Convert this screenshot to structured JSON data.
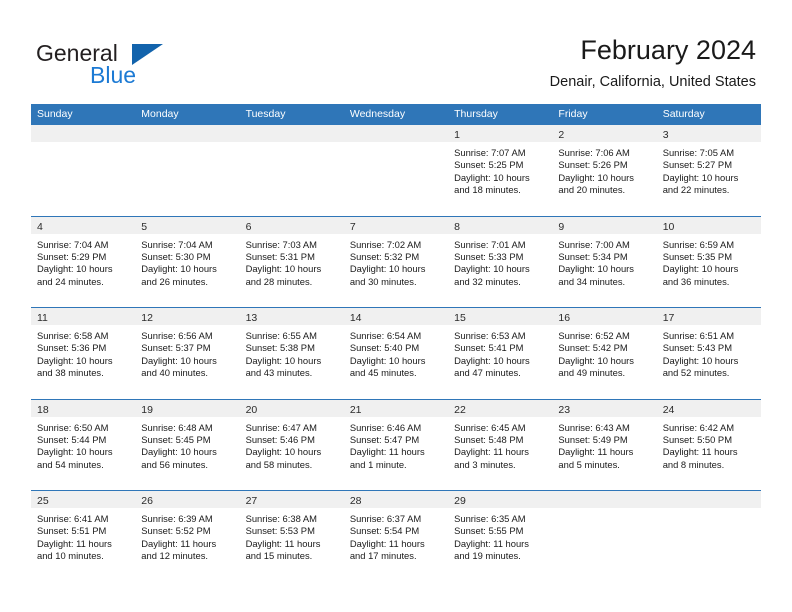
{
  "brand": {
    "name_part1": "General",
    "name_part2": "Blue",
    "accent_color": "#1263ac",
    "blue_text_color": "#1c7ad4"
  },
  "header": {
    "title": "February 2024",
    "subtitle": "Denair, California, United States"
  },
  "theme": {
    "header_row_bg": "#2f76b8",
    "day_number_band_bg": "#f0f0f0",
    "separator_color": "#2f76b8",
    "text_color": "#1a1a1a"
  },
  "weekday_headers": [
    "Sunday",
    "Monday",
    "Tuesday",
    "Wednesday",
    "Thursday",
    "Friday",
    "Saturday"
  ],
  "weeks": [
    [
      {
        "day": "",
        "sunrise": "",
        "sunset": "",
        "daylight_line1": "",
        "daylight_line2": ""
      },
      {
        "day": "",
        "sunrise": "",
        "sunset": "",
        "daylight_line1": "",
        "daylight_line2": ""
      },
      {
        "day": "",
        "sunrise": "",
        "sunset": "",
        "daylight_line1": "",
        "daylight_line2": ""
      },
      {
        "day": "",
        "sunrise": "",
        "sunset": "",
        "daylight_line1": "",
        "daylight_line2": ""
      },
      {
        "day": "1",
        "sunrise": "Sunrise: 7:07 AM",
        "sunset": "Sunset: 5:25 PM",
        "daylight_line1": "Daylight: 10 hours",
        "daylight_line2": "and 18 minutes."
      },
      {
        "day": "2",
        "sunrise": "Sunrise: 7:06 AM",
        "sunset": "Sunset: 5:26 PM",
        "daylight_line1": "Daylight: 10 hours",
        "daylight_line2": "and 20 minutes."
      },
      {
        "day": "3",
        "sunrise": "Sunrise: 7:05 AM",
        "sunset": "Sunset: 5:27 PM",
        "daylight_line1": "Daylight: 10 hours",
        "daylight_line2": "and 22 minutes."
      }
    ],
    [
      {
        "day": "4",
        "sunrise": "Sunrise: 7:04 AM",
        "sunset": "Sunset: 5:29 PM",
        "daylight_line1": "Daylight: 10 hours",
        "daylight_line2": "and 24 minutes."
      },
      {
        "day": "5",
        "sunrise": "Sunrise: 7:04 AM",
        "sunset": "Sunset: 5:30 PM",
        "daylight_line1": "Daylight: 10 hours",
        "daylight_line2": "and 26 minutes."
      },
      {
        "day": "6",
        "sunrise": "Sunrise: 7:03 AM",
        "sunset": "Sunset: 5:31 PM",
        "daylight_line1": "Daylight: 10 hours",
        "daylight_line2": "and 28 minutes."
      },
      {
        "day": "7",
        "sunrise": "Sunrise: 7:02 AM",
        "sunset": "Sunset: 5:32 PM",
        "daylight_line1": "Daylight: 10 hours",
        "daylight_line2": "and 30 minutes."
      },
      {
        "day": "8",
        "sunrise": "Sunrise: 7:01 AM",
        "sunset": "Sunset: 5:33 PM",
        "daylight_line1": "Daylight: 10 hours",
        "daylight_line2": "and 32 minutes."
      },
      {
        "day": "9",
        "sunrise": "Sunrise: 7:00 AM",
        "sunset": "Sunset: 5:34 PM",
        "daylight_line1": "Daylight: 10 hours",
        "daylight_line2": "and 34 minutes."
      },
      {
        "day": "10",
        "sunrise": "Sunrise: 6:59 AM",
        "sunset": "Sunset: 5:35 PM",
        "daylight_line1": "Daylight: 10 hours",
        "daylight_line2": "and 36 minutes."
      }
    ],
    [
      {
        "day": "11",
        "sunrise": "Sunrise: 6:58 AM",
        "sunset": "Sunset: 5:36 PM",
        "daylight_line1": "Daylight: 10 hours",
        "daylight_line2": "and 38 minutes."
      },
      {
        "day": "12",
        "sunrise": "Sunrise: 6:56 AM",
        "sunset": "Sunset: 5:37 PM",
        "daylight_line1": "Daylight: 10 hours",
        "daylight_line2": "and 40 minutes."
      },
      {
        "day": "13",
        "sunrise": "Sunrise: 6:55 AM",
        "sunset": "Sunset: 5:38 PM",
        "daylight_line1": "Daylight: 10 hours",
        "daylight_line2": "and 43 minutes."
      },
      {
        "day": "14",
        "sunrise": "Sunrise: 6:54 AM",
        "sunset": "Sunset: 5:40 PM",
        "daylight_line1": "Daylight: 10 hours",
        "daylight_line2": "and 45 minutes."
      },
      {
        "day": "15",
        "sunrise": "Sunrise: 6:53 AM",
        "sunset": "Sunset: 5:41 PM",
        "daylight_line1": "Daylight: 10 hours",
        "daylight_line2": "and 47 minutes."
      },
      {
        "day": "16",
        "sunrise": "Sunrise: 6:52 AM",
        "sunset": "Sunset: 5:42 PM",
        "daylight_line1": "Daylight: 10 hours",
        "daylight_line2": "and 49 minutes."
      },
      {
        "day": "17",
        "sunrise": "Sunrise: 6:51 AM",
        "sunset": "Sunset: 5:43 PM",
        "daylight_line1": "Daylight: 10 hours",
        "daylight_line2": "and 52 minutes."
      }
    ],
    [
      {
        "day": "18",
        "sunrise": "Sunrise: 6:50 AM",
        "sunset": "Sunset: 5:44 PM",
        "daylight_line1": "Daylight: 10 hours",
        "daylight_line2": "and 54 minutes."
      },
      {
        "day": "19",
        "sunrise": "Sunrise: 6:48 AM",
        "sunset": "Sunset: 5:45 PM",
        "daylight_line1": "Daylight: 10 hours",
        "daylight_line2": "and 56 minutes."
      },
      {
        "day": "20",
        "sunrise": "Sunrise: 6:47 AM",
        "sunset": "Sunset: 5:46 PM",
        "daylight_line1": "Daylight: 10 hours",
        "daylight_line2": "and 58 minutes."
      },
      {
        "day": "21",
        "sunrise": "Sunrise: 6:46 AM",
        "sunset": "Sunset: 5:47 PM",
        "daylight_line1": "Daylight: 11 hours",
        "daylight_line2": "and 1 minute."
      },
      {
        "day": "22",
        "sunrise": "Sunrise: 6:45 AM",
        "sunset": "Sunset: 5:48 PM",
        "daylight_line1": "Daylight: 11 hours",
        "daylight_line2": "and 3 minutes."
      },
      {
        "day": "23",
        "sunrise": "Sunrise: 6:43 AM",
        "sunset": "Sunset: 5:49 PM",
        "daylight_line1": "Daylight: 11 hours",
        "daylight_line2": "and 5 minutes."
      },
      {
        "day": "24",
        "sunrise": "Sunrise: 6:42 AM",
        "sunset": "Sunset: 5:50 PM",
        "daylight_line1": "Daylight: 11 hours",
        "daylight_line2": "and 8 minutes."
      }
    ],
    [
      {
        "day": "25",
        "sunrise": "Sunrise: 6:41 AM",
        "sunset": "Sunset: 5:51 PM",
        "daylight_line1": "Daylight: 11 hours",
        "daylight_line2": "and 10 minutes."
      },
      {
        "day": "26",
        "sunrise": "Sunrise: 6:39 AM",
        "sunset": "Sunset: 5:52 PM",
        "daylight_line1": "Daylight: 11 hours",
        "daylight_line2": "and 12 minutes."
      },
      {
        "day": "27",
        "sunrise": "Sunrise: 6:38 AM",
        "sunset": "Sunset: 5:53 PM",
        "daylight_line1": "Daylight: 11 hours",
        "daylight_line2": "and 15 minutes."
      },
      {
        "day": "28",
        "sunrise": "Sunrise: 6:37 AM",
        "sunset": "Sunset: 5:54 PM",
        "daylight_line1": "Daylight: 11 hours",
        "daylight_line2": "and 17 minutes."
      },
      {
        "day": "29",
        "sunrise": "Sunrise: 6:35 AM",
        "sunset": "Sunset: 5:55 PM",
        "daylight_line1": "Daylight: 11 hours",
        "daylight_line2": "and 19 minutes."
      },
      {
        "day": "",
        "sunrise": "",
        "sunset": "",
        "daylight_line1": "",
        "daylight_line2": ""
      },
      {
        "day": "",
        "sunrise": "",
        "sunset": "",
        "daylight_line1": "",
        "daylight_line2": ""
      }
    ]
  ]
}
